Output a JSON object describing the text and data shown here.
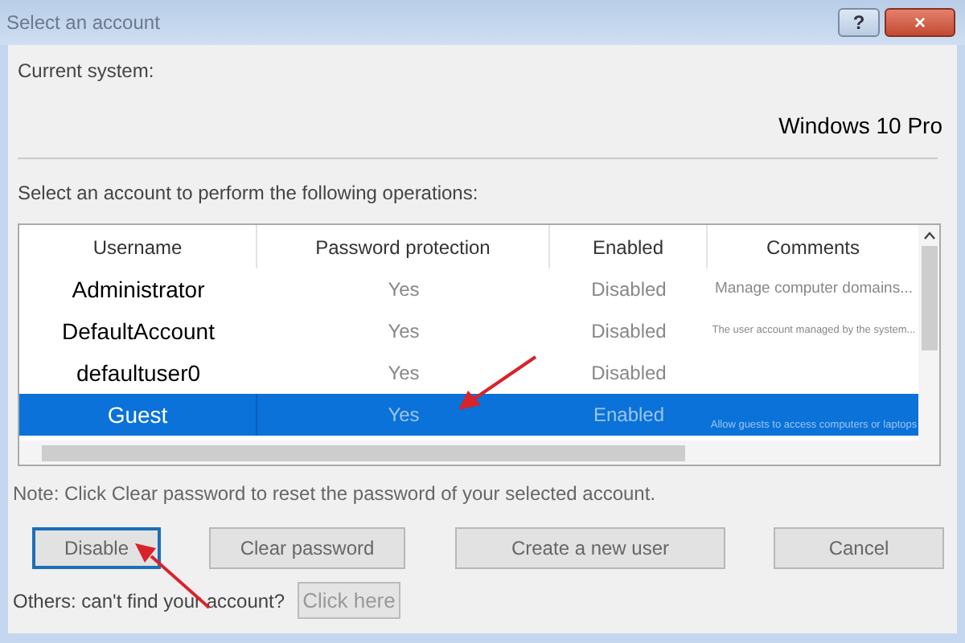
{
  "window": {
    "title": "Select an account",
    "buttons": [
      "?",
      "×"
    ]
  },
  "current_system": {
    "label": "Current system:",
    "value": "Windows 10 Pro"
  },
  "instruction": "Select an account to perform the following operations:",
  "table": {
    "columns": [
      "Username",
      "Password protection",
      "Enabled",
      "Comments"
    ],
    "rows": [
      {
        "cells": [
          "Administrator",
          "Yes",
          "Disabled",
          "Manage computer domains..."
        ],
        "selected": false
      },
      {
        "cells": [
          "DefaultAccount",
          "Yes",
          "Disabled",
          "The user account managed by the system..."
        ],
        "selected": false
      },
      {
        "cells": [
          "defaultuser0",
          "Yes",
          "Disabled",
          ""
        ],
        "selected": false
      },
      {
        "cells": [
          "Guest",
          "Yes",
          "Enabled",
          "Allow guests to access computers or laptops"
        ],
        "selected": true
      }
    ]
  },
  "note": "Note: Click Clear password to reset the password of your selected account.",
  "buttons": [
    {
      "label": "Disable",
      "focused": true
    },
    {
      "label": "Clear password",
      "focused": false
    },
    {
      "label": "Create a new user",
      "focused": false
    },
    {
      "label": "Cancel",
      "focused": false
    }
  ],
  "others": {
    "label": "Others: can't find your account?",
    "link": "Click here"
  }
}
